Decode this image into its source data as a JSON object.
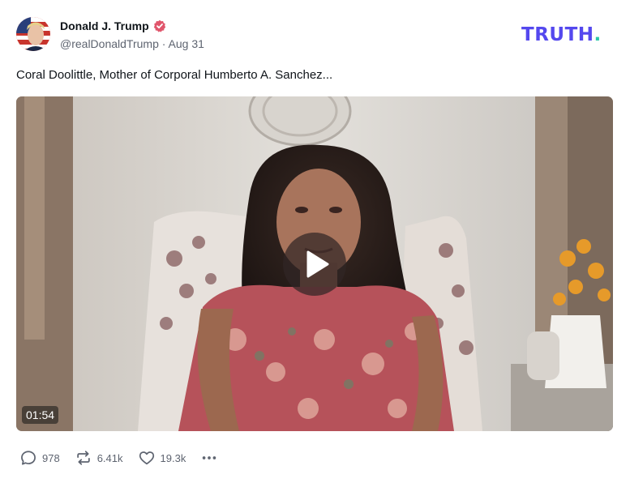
{
  "author": {
    "display_name": "Donald J. Trump",
    "handle": "@realDonaldTrump",
    "separator": " · ",
    "date": "Aug 31",
    "verified": true
  },
  "brand": {
    "wordmark": "TRUTH",
    "dot": ".",
    "color": "#5448ee",
    "dot_color": "#2cc7a7"
  },
  "post": {
    "text": "Coral Doolittle, Mother of Corporal Humberto A. Sanchez..."
  },
  "video": {
    "duration": "01:54",
    "play_icon": "play-icon"
  },
  "actions": {
    "replies": {
      "icon": "reply-icon",
      "count": "978"
    },
    "retruths": {
      "icon": "retruth-icon",
      "count": "6.41k"
    },
    "likes": {
      "icon": "heart-icon",
      "count": "19.3k"
    },
    "more": {
      "icon": "more-icon"
    }
  }
}
